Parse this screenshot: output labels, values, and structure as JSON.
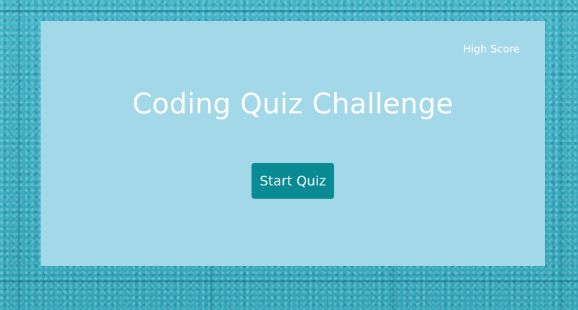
{
  "colors": {
    "background_water": "#36b0c6",
    "card_background": "#a3d8e9",
    "button_background": "#0a8a93",
    "text": "#ffffff"
  },
  "header": {
    "high_score_label": "High Score"
  },
  "main": {
    "title": "Coding Quiz Challenge",
    "start_button_label": "Start Quiz"
  }
}
